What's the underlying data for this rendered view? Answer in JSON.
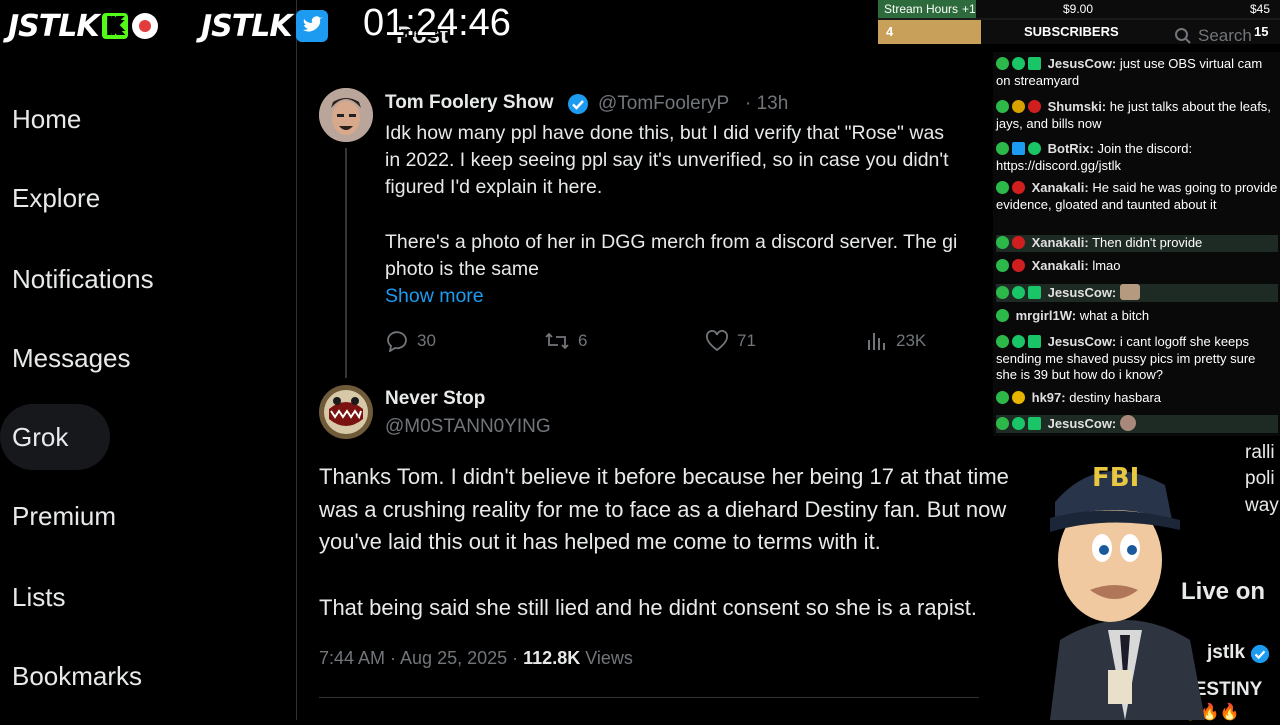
{
  "sidebar": {
    "items": [
      {
        "label": "Home"
      },
      {
        "label": "Explore"
      },
      {
        "label": "Notifications"
      },
      {
        "label": "Messages"
      },
      {
        "label": "Grok"
      },
      {
        "label": "Premium"
      },
      {
        "label": "Lists"
      },
      {
        "label": "Bookmarks"
      }
    ]
  },
  "header": {
    "title": "Post",
    "search_placeholder": "Search"
  },
  "tweet1": {
    "name": "Tom Foolery Show",
    "handle": "@TomFooleryP",
    "time": "· 13h",
    "lines": [
      "Idk how many ppl have done this, but I did verify that \"Rose\" was",
      "in 2022. I keep seeing ppl say it's unverified, so in case you didn't",
      "figured I'd explain it here.",
      "There's a photo of her in DGG merch from a discord server. The gi",
      "photo is the same"
    ],
    "show_more": "Show more",
    "replies": "30",
    "reposts": "6",
    "likes": "71",
    "views": "23K"
  },
  "tweet2": {
    "name": "Never Stop",
    "handle": "@M0STANN0YING",
    "lines": [
      "Thanks Tom. I didn't believe it before because her being 17 at that time",
      "was a crushing reality for me to face as a diehard Destiny fan. But now",
      "you've laid this out it has helped me come to terms with it.",
      "That being said she still lied and he didnt consent so she is a rapist."
    ],
    "date": "7:44 AM · Aug 25, 2025 ·",
    "views_count": "112.8K",
    "views_label": "Views"
  },
  "overlay": {
    "logo1": "JSTLK",
    "logo2": "JSTLK",
    "timer": "01:24:46"
  },
  "widget": {
    "stream_hours": "Stream Hours",
    "stream_hours_delta": "+1",
    "price1": "$9.00",
    "price2": "$45",
    "subscribers_label": "SUBSCRIBERS",
    "sub_current": "4",
    "sub_goal": "15"
  },
  "chat": [
    {
      "user": "JesusCow:",
      "text": "just use OBS virtual cam on streamyard"
    },
    {
      "user": "Shumski:",
      "text": "he just talks about the leafs, jays, and bills now"
    },
    {
      "user": "BotRix:",
      "text": "Join the discord: https://discord.gg/jstlk"
    },
    {
      "user": "Xanakali:",
      "text": "He said he was going to provide evidence, gloated and taunted about it"
    },
    {
      "user": "Xanakali:",
      "text": "Then didn't provide"
    },
    {
      "user": "Xanakali:",
      "text": "lmao"
    },
    {
      "user": "JesusCow:",
      "text": ""
    },
    {
      "user": "mrgirl1W:",
      "text": "what a bitch"
    },
    {
      "user": "JesusCow:",
      "text": "i cant logoff she keeps sending me shaved pussy pics im pretty sure she is 39 but how do i know?"
    },
    {
      "user": "hk97:",
      "text": "destiny hasbara"
    },
    {
      "user": "JesusCow:",
      "text": ""
    }
  ],
  "right_column": {
    "frag1": "ralli",
    "frag2": "poli",
    "frag3": "way",
    "live_on": "Live on",
    "jstlk": "jstlk",
    "destiny": "DESTINY"
  },
  "mascot": {
    "cap_text": "FBI"
  },
  "colors": {
    "accent": "#1d9bf0",
    "verified": "#1d9bf0",
    "widget_gold": "#c8a05a"
  }
}
